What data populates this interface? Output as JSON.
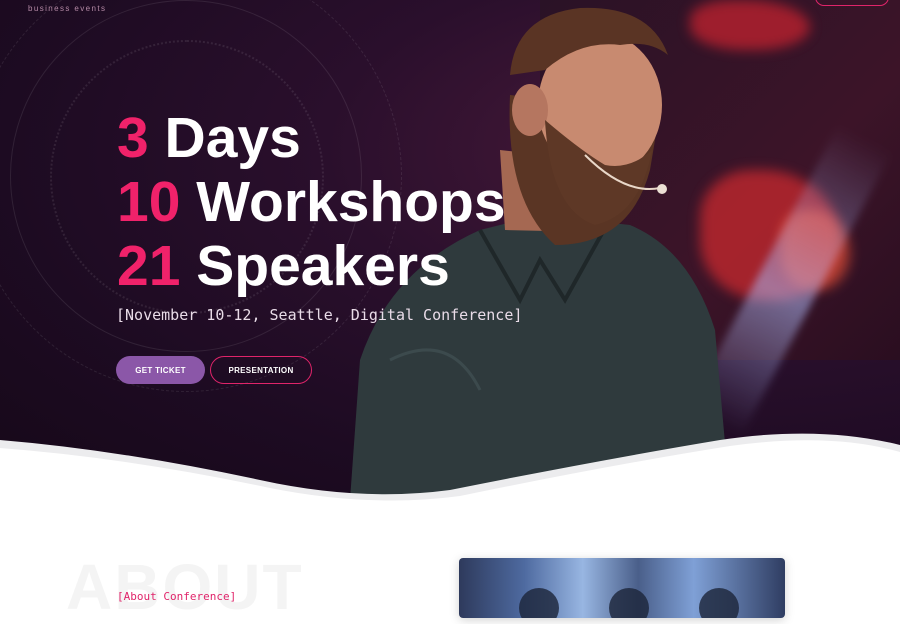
{
  "header": {
    "logo_sub": "business events"
  },
  "hero": {
    "lines": [
      {
        "number": "3",
        "text": " Days"
      },
      {
        "number": "10",
        "text": " Workshops"
      },
      {
        "number": "21",
        "text": " Speakers"
      }
    ],
    "dateline": "[November 10-12, Seattle, Digital Conference]",
    "buttons": {
      "primary": "GET TICKET",
      "secondary": "PRESENTATION"
    }
  },
  "about": {
    "ghost_title": "ABOUT",
    "label": "[About Conference]"
  },
  "colors": {
    "accent": "#f0226a",
    "primary_button": "#8b57a8",
    "hero_bg": "#1d0b22"
  }
}
